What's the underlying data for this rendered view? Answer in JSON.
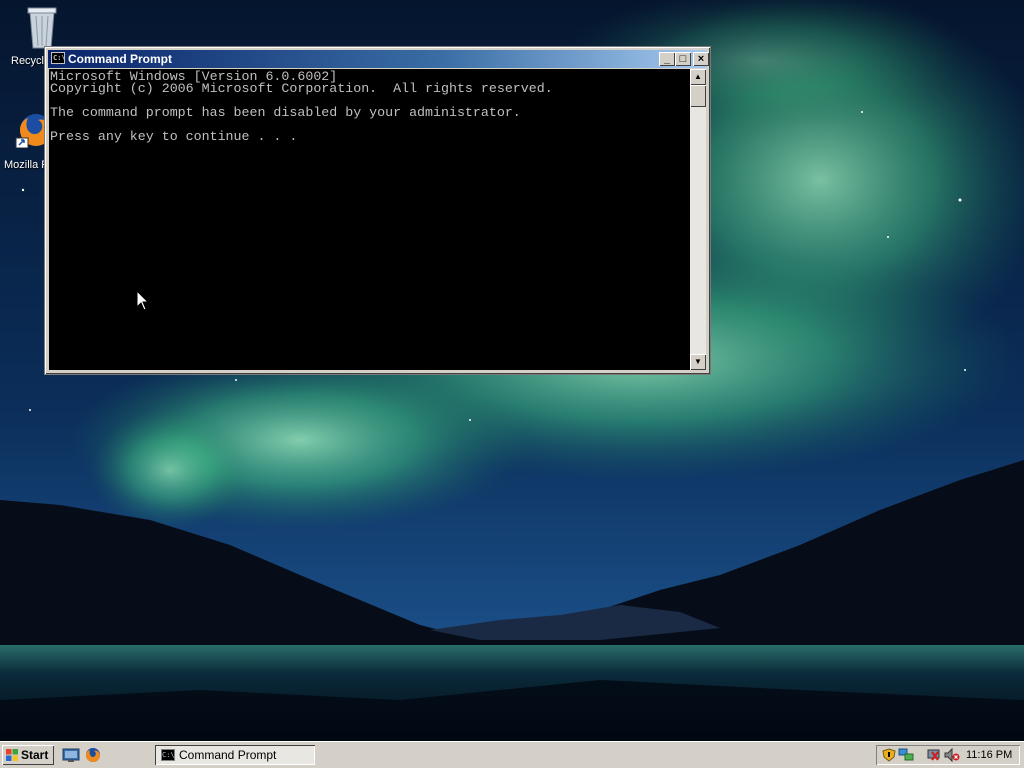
{
  "desktop": {
    "icons": [
      {
        "name": "recycle-bin",
        "label": "Recycle Bin"
      },
      {
        "name": "mozilla-firefox",
        "label": "Mozilla Firefox"
      }
    ]
  },
  "window": {
    "title": "Command Prompt",
    "minimize_label": "_",
    "maximize_label": "□",
    "close_label": "×",
    "console_lines": [
      "Microsoft Windows [Version 6.0.6002]",
      "Copyright (c) 2006 Microsoft Corporation.  All rights reserved.",
      "",
      "The command prompt has been disabled by your administrator.",
      "",
      "Press any key to continue . . ."
    ]
  },
  "taskbar": {
    "start_label": "Start",
    "quick_launch": [
      "show-desktop-icon",
      "firefox-icon"
    ],
    "tasks": [
      {
        "label": "Command Prompt",
        "active": true
      }
    ],
    "tray_icons": [
      "security-shield-icon",
      "network-icon",
      "network-disconnected-icon",
      "volume-muted-icon"
    ],
    "clock": "11:16 PM"
  },
  "colors": {
    "console_bg": "#000000",
    "console_text": "#c0c0c0",
    "titlebar_start": "#0a246a",
    "titlebar_end": "#a6caf0",
    "taskbar": "#d4d0c8"
  }
}
